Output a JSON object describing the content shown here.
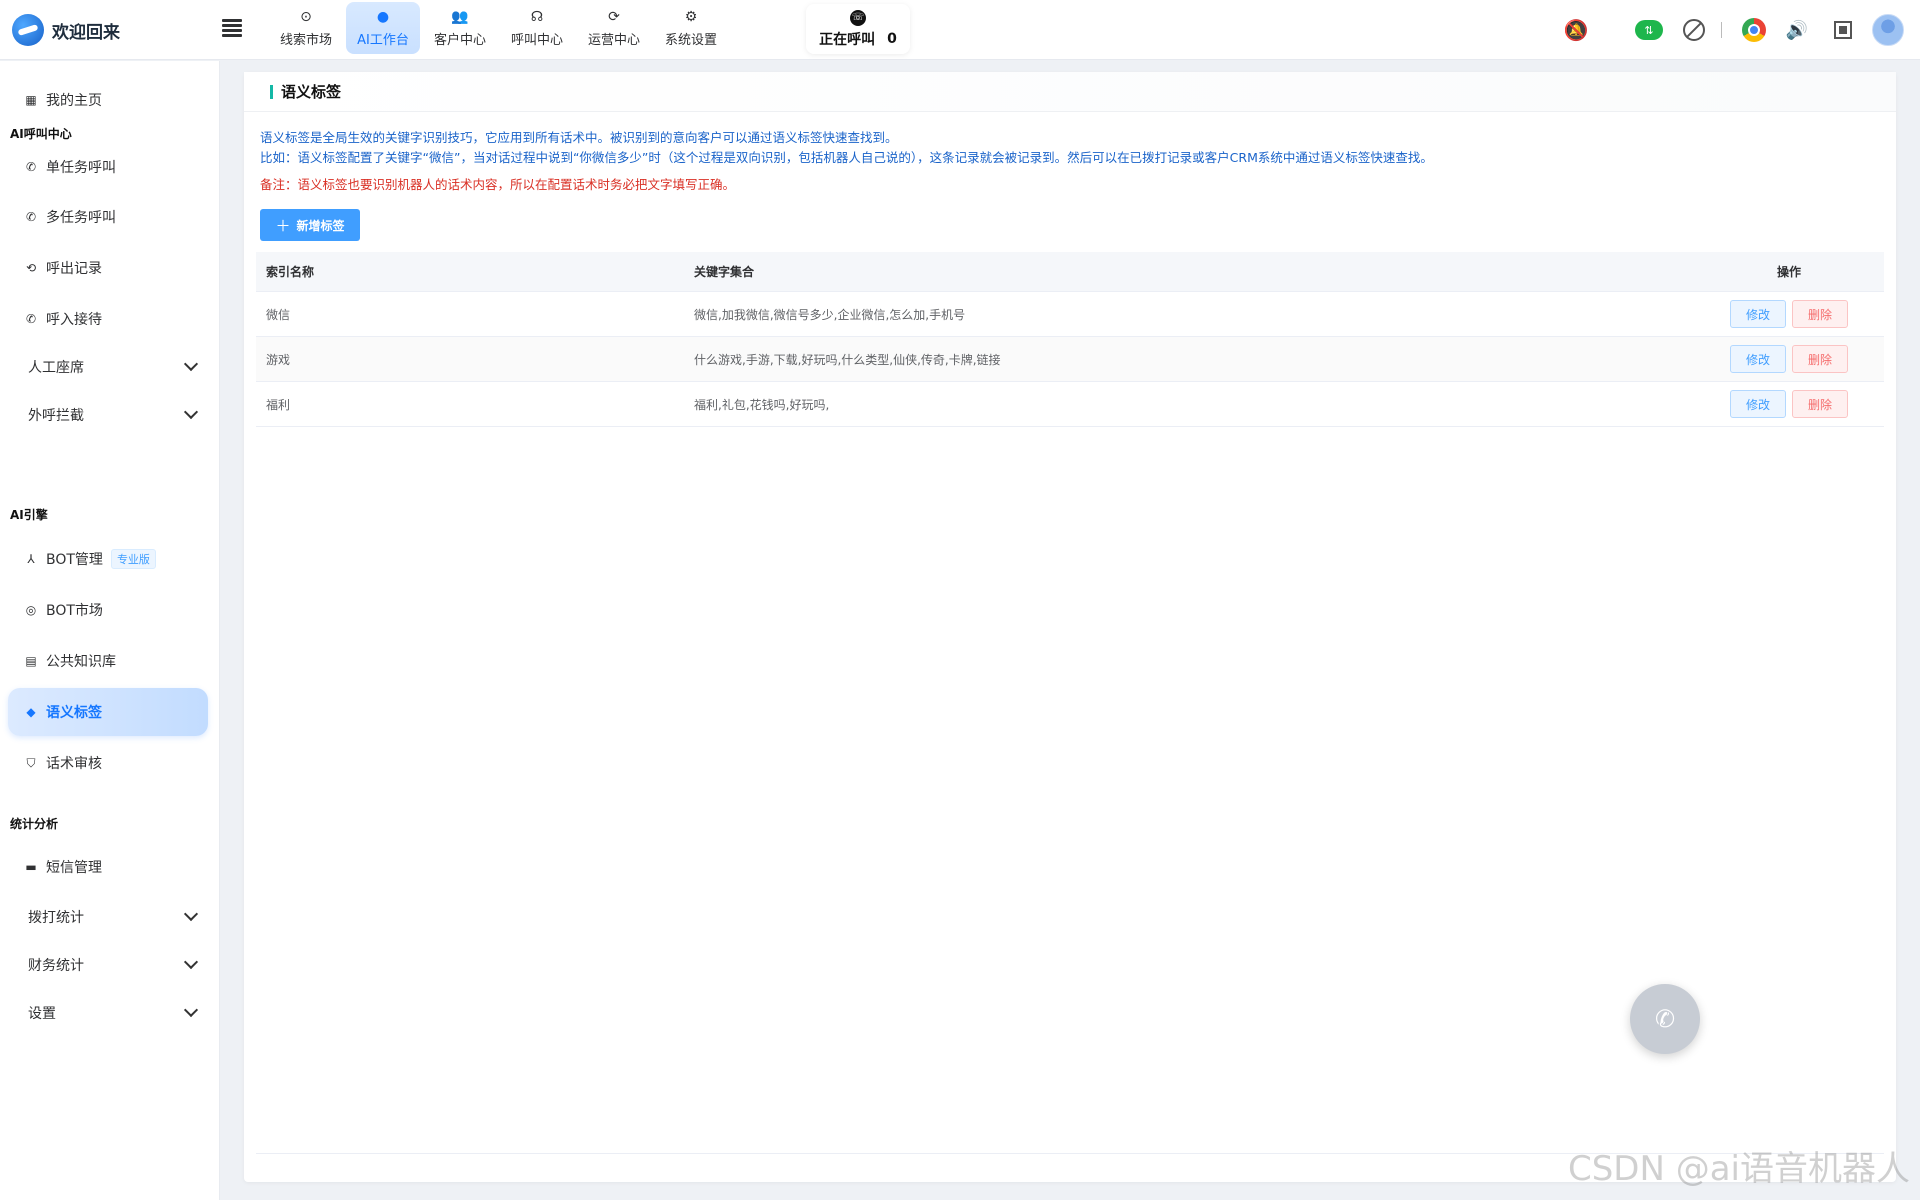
{
  "brand": {
    "title": "欢迎回来"
  },
  "topnav": [
    {
      "label": "线索市场",
      "icon": "⊙",
      "name": "tab-leads-market",
      "active": false
    },
    {
      "label": "AI工作台",
      "icon": "●",
      "name": "tab-ai-workbench",
      "active": true
    },
    {
      "label": "客户中心",
      "icon": "👥",
      "name": "tab-customer-center",
      "active": false
    },
    {
      "label": "呼叫中心",
      "icon": "☊",
      "name": "tab-call-center",
      "active": false
    },
    {
      "label": "运营中心",
      "icon": "⟳",
      "name": "tab-operations-center",
      "active": false
    },
    {
      "label": "系统设置",
      "icon": "⚙",
      "name": "tab-system-settings",
      "active": false
    }
  ],
  "calling": {
    "label": "正在呼叫",
    "count": "0"
  },
  "sidebar": {
    "home": "我的主页",
    "group_ai_call": "AI呼叫中心",
    "single_task_call": "单任务呼叫",
    "multi_task_call": "多任务呼叫",
    "outbound_records": "呼出记录",
    "inbound_reception": "呼入接待",
    "manual_seat": "人工座席",
    "outbound_intercept": "外呼拦截",
    "group_ai_engine": "AI引擎",
    "bot_manage": "BOT管理",
    "pro_badge": "专业版",
    "bot_market": "BOT市场",
    "public_kb": "公共知识库",
    "semantic_tags": "语义标签",
    "script_review": "话术审核",
    "group_stats": "统计分析",
    "sms_manage": "短信管理",
    "dial_stats": "拨打统计",
    "finance_stats": "财务统计",
    "settings": "设置"
  },
  "panel": {
    "title": "语义标签",
    "desc_line1": "语义标签是全局生效的关键字识别技巧，它应用到所有话术中。被识别到的意向客户可以通过语义标签快速查找到。",
    "desc_line2": "比如：语义标签配置了关键字“微信”，当对话过程中说到“你微信多少”时（这个过程是双向识别，包括机器人自己说的），这条记录就会被记录到。然后可以在已拨打记录或客户CRM系统中通过语义标签快速查找。",
    "note": "备注：语义标签也要识别机器人的话术内容，所以在配置话术时务必把文字填写正确。",
    "add_button": "新增标签"
  },
  "table": {
    "headers": {
      "name": "索引名称",
      "keywords": "关键字集合",
      "ops": "操作"
    },
    "edit_label": "修改",
    "delete_label": "删除",
    "rows": [
      {
        "name": "微信",
        "keywords": "微信,加我微信,微信号多少,企业微信,怎么加,手机号"
      },
      {
        "name": "游戏",
        "keywords": "什么游戏,手游,下载,好玩吗,什么类型,仙侠,传奇,卡牌,链接"
      },
      {
        "name": "福利",
        "keywords": "福利,礼包,花钱吗,好玩吗,"
      }
    ]
  },
  "watermark": "CSDN @ai语音机器人",
  "colors": {
    "accent": "#409eff",
    "active_tab": "#1677ff",
    "danger": "#f56c6c",
    "desc_blue": "#1a63c9",
    "note_red": "#d93025"
  },
  "icons": {
    "bell": "bell-off-icon",
    "cloud": "cloud-upload-icon",
    "block": "block-icon",
    "browser": "chrome-icon",
    "volume": "volume-icon",
    "fullscreen": "fullscreen-icon",
    "avatar": "user-avatar-icon"
  }
}
